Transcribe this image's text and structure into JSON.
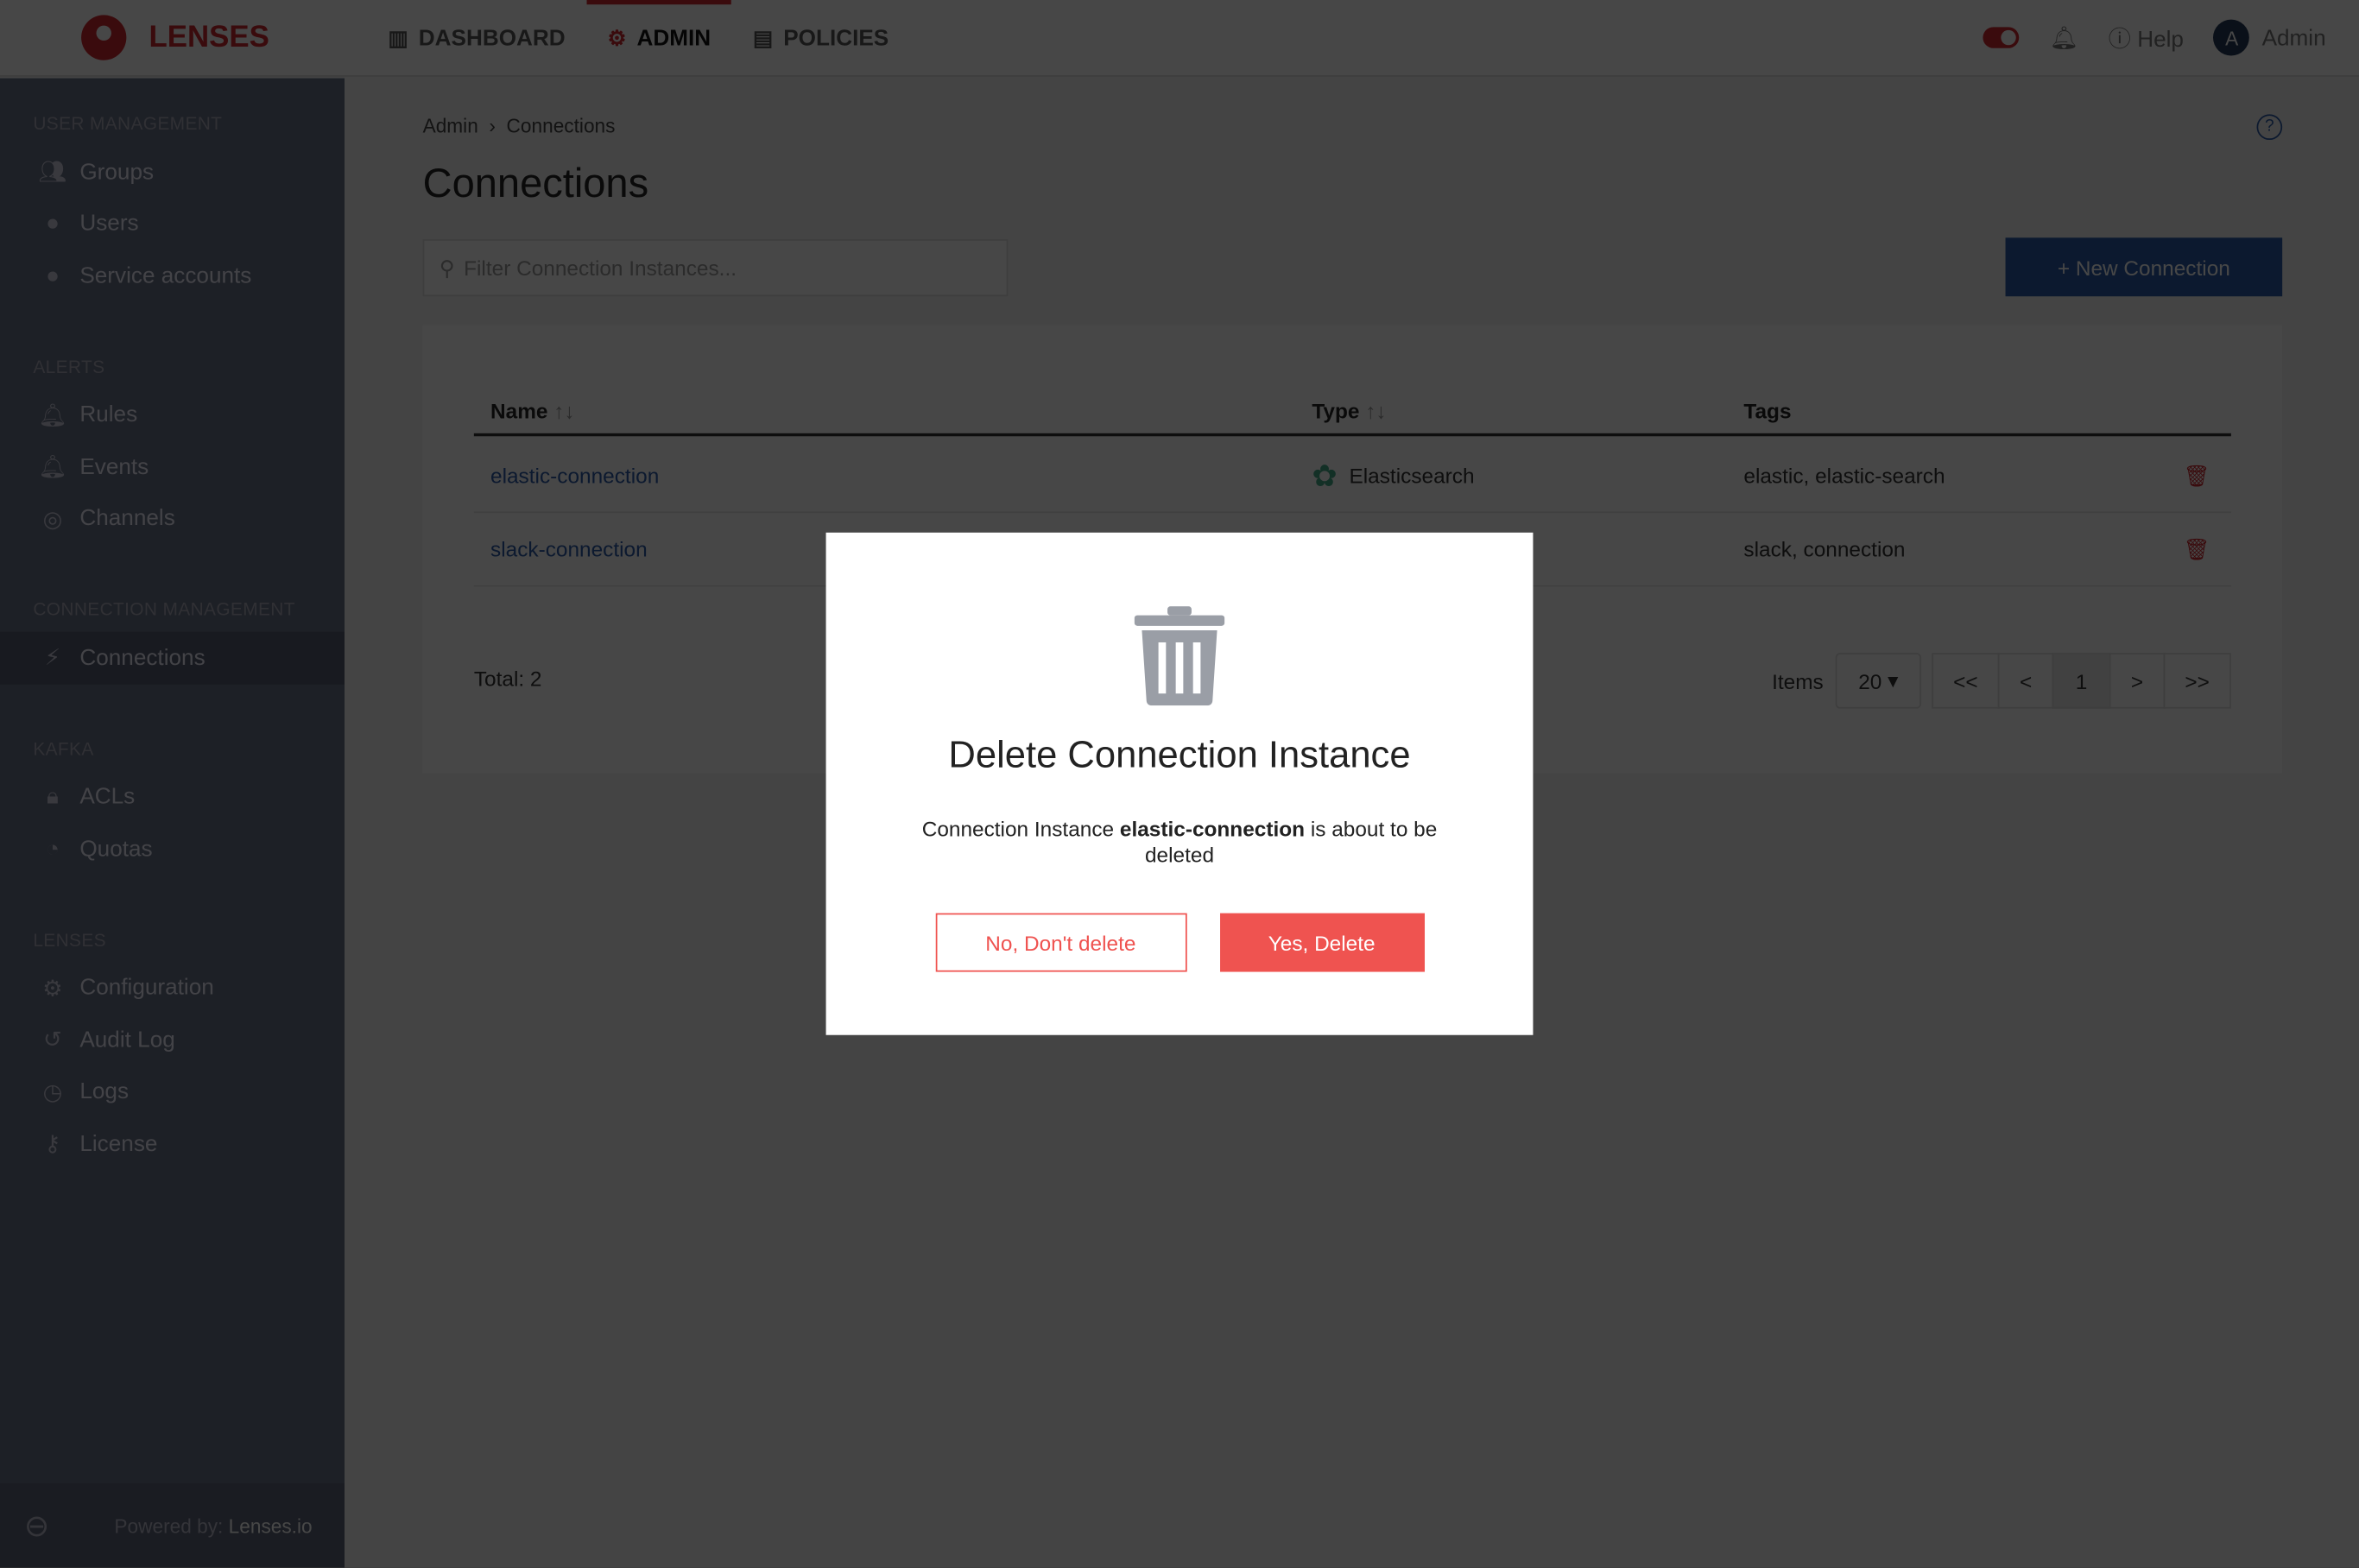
{
  "brand": "LENSES",
  "nav": [
    {
      "label": "DASHBOARD",
      "icon": "bar-chart-icon"
    },
    {
      "label": "ADMIN",
      "icon": "gear-icon",
      "active": true
    },
    {
      "label": "POLICIES",
      "icon": "policy-card-icon"
    }
  ],
  "top_right": {
    "help": "Help",
    "avatar_letter": "A",
    "user": "Admin"
  },
  "sidebar": {
    "sections": [
      {
        "title": "USER MANAGEMENT",
        "items": [
          {
            "label": "Groups"
          },
          {
            "label": "Users"
          },
          {
            "label": "Service accounts"
          }
        ]
      },
      {
        "title": "ALERTS",
        "items": [
          {
            "label": "Rules"
          },
          {
            "label": "Events"
          },
          {
            "label": "Channels"
          }
        ]
      },
      {
        "title": "CONNECTION MANAGEMENT",
        "items": [
          {
            "label": "Connections",
            "active": true
          }
        ]
      },
      {
        "title": "KAFKA",
        "items": [
          {
            "label": "ACLs"
          },
          {
            "label": "Quotas"
          }
        ]
      },
      {
        "title": "LENSES",
        "items": [
          {
            "label": "Configuration"
          },
          {
            "label": "Audit Log"
          },
          {
            "label": "Logs"
          },
          {
            "label": "License"
          }
        ]
      }
    ],
    "footer_prefix": "Powered by:",
    "footer_link": "Lenses.io"
  },
  "breadcrumb": [
    "Admin",
    "Connections"
  ],
  "page_title": "Connections",
  "filter_placeholder": "Filter Connection Instances...",
  "new_button": "+ New Connection",
  "table": {
    "headers": [
      "Name",
      "Type",
      "Tags"
    ],
    "rows": [
      {
        "name": "elastic-connection",
        "type": "Elasticsearch",
        "tags": "elastic, elastic-search"
      },
      {
        "name": "slack-connection",
        "type": "",
        "tags": "slack, connection"
      }
    ]
  },
  "total": "Total: 2",
  "pager": {
    "items_label": "Items",
    "page_size": "20",
    "first": "<<",
    "prev": "<",
    "page": "1",
    "next": ">",
    "last": ">>"
  },
  "modal": {
    "title": "Delete Connection Instance",
    "text_pre": "Connection Instance",
    "name": "elastic-connection",
    "text_post": "is about to be deleted",
    "cancel": "No, Don't delete",
    "confirm": "Yes, Delete"
  },
  "colors": {
    "brand": "#d0262d",
    "primary": "#2a5ba8",
    "danger": "#ef5350"
  }
}
